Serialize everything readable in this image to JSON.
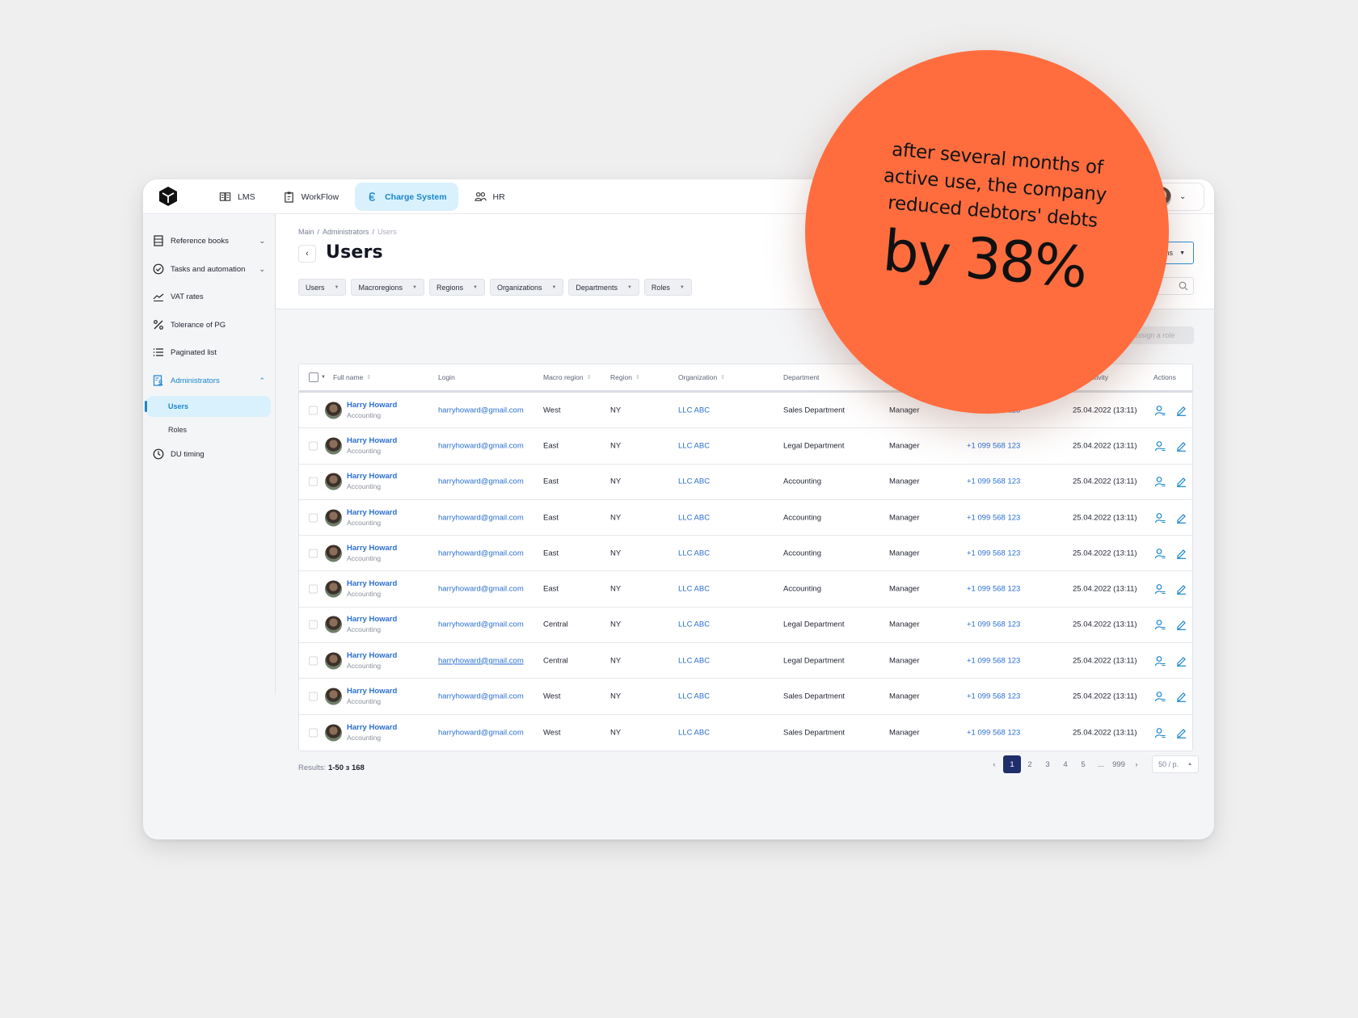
{
  "nav": {
    "items": [
      {
        "label": "LMS",
        "icon": "book-icon",
        "active": false
      },
      {
        "label": "WorkFlow",
        "icon": "clipboard-icon",
        "active": false
      },
      {
        "label": "Charge System",
        "icon": "charge-icon",
        "active": true
      },
      {
        "label": "HR",
        "icon": "people-icon",
        "active": false
      }
    ]
  },
  "sidebar": {
    "items": [
      {
        "label": "Reference books",
        "icon": "book-list-icon",
        "expandable": "down"
      },
      {
        "label": "Tasks and automation",
        "icon": "check-circle-icon",
        "expandable": "down"
      },
      {
        "label": "VAT rates",
        "icon": "trend-icon"
      },
      {
        "label": "Tolerance of PG",
        "icon": "percent-icon"
      },
      {
        "label": "Paginated list",
        "icon": "list-icon"
      },
      {
        "label": "Administrators",
        "icon": "admin-icon",
        "expandable": "up",
        "active": true
      },
      {
        "label": "DU timing",
        "icon": "clock-icon"
      }
    ],
    "subitems": [
      {
        "label": "Users",
        "active": true
      },
      {
        "label": "Roles",
        "active": false
      }
    ]
  },
  "breadcrumb": [
    "Main",
    "Administrators",
    "Users"
  ],
  "page": {
    "title": "Users",
    "right_select_label": "ns",
    "reassign_label": "Reassign a role"
  },
  "filters": [
    "Users",
    "Macroregions",
    "Regions",
    "Organizations",
    "Departments",
    "Roles"
  ],
  "table": {
    "columns": [
      "Full name",
      "Login",
      "Macro region",
      "Region",
      "Organization",
      "Department",
      "",
      "",
      "activity",
      "Actions"
    ],
    "rows": [
      {
        "name": "Harry Howard",
        "sub": "Accounting",
        "login": "harryhoward@gmail.com",
        "macro": "West",
        "region": "NY",
        "org": "LLC ABC",
        "dept": "Sales Department",
        "role": "Manager",
        "phone": "+1 099 568 123",
        "activity": "25.04.2022 (13:11)"
      },
      {
        "name": "Harry Howard",
        "sub": "Accounting",
        "login": "harryhoward@gmail.com",
        "macro": "East",
        "region": "NY",
        "org": "LLC ABC",
        "dept": "Legal Department",
        "role": "Manager",
        "phone": "+1 099 568 123",
        "activity": "25.04.2022 (13:11)"
      },
      {
        "name": "Harry Howard",
        "sub": "Accounting",
        "login": "harryhoward@gmail.com",
        "macro": "East",
        "region": "NY",
        "org": "LLC ABC",
        "dept": "Accounting",
        "role": "Manager",
        "phone": "+1 099 568 123",
        "activity": "25.04.2022 (13:11)"
      },
      {
        "name": "Harry Howard",
        "sub": "Accounting",
        "login": "harryhoward@gmail.com",
        "macro": "East",
        "region": "NY",
        "org": "LLC ABC",
        "dept": "Accounting",
        "role": "Manager",
        "phone": "+1 099 568 123",
        "activity": "25.04.2022 (13:11)"
      },
      {
        "name": "Harry Howard",
        "sub": "Accounting",
        "login": "harryhoward@gmail.com",
        "macro": "East",
        "region": "NY",
        "org": "LLC ABC",
        "dept": "Accounting",
        "role": "Manager",
        "phone": "+1 099 568 123",
        "activity": "25.04.2022 (13:11)"
      },
      {
        "name": "Harry Howard",
        "sub": "Accounting",
        "login": "harryhoward@gmail.com",
        "macro": "East",
        "region": "NY",
        "org": "LLC ABC",
        "dept": "Accounting",
        "role": "Manager",
        "phone": "+1 099 568 123",
        "activity": "25.04.2022 (13:11)"
      },
      {
        "name": "Harry Howard",
        "sub": "Accounting",
        "login": "harryhoward@gmail.com",
        "macro": "Central",
        "region": "NY",
        "org": "LLC ABC",
        "dept": "Legal Department",
        "role": "Manager",
        "phone": "+1 099 568 123",
        "activity": "25.04.2022 (13:11)"
      },
      {
        "name": "Harry Howard",
        "sub": "Accounting",
        "login": "harryhoward@gmail.com",
        "macro": "Central",
        "region": "NY",
        "org": "LLC ABC",
        "dept": "Legal Department",
        "role": "Manager",
        "phone": "+1 099 568 123",
        "activity": "25.04.2022 (13:11)",
        "hover": true
      },
      {
        "name": "Harry Howard",
        "sub": "Accounting",
        "login": "harryhoward@gmail.com",
        "macro": "West",
        "region": "NY",
        "org": "LLC ABC",
        "dept": "Sales Department",
        "role": "Manager",
        "phone": "+1 099 568 123",
        "activity": "25.04.2022 (13:11)"
      },
      {
        "name": "Harry Howard",
        "sub": "Accounting",
        "login": "harryhoward@gmail.com",
        "macro": "West",
        "region": "NY",
        "org": "LLC ABC",
        "dept": "Sales Department",
        "role": "Manager",
        "phone": "+1 099 568 123",
        "activity": "25.04.2022 (13:11)"
      }
    ]
  },
  "footer": {
    "results_label": "Results:",
    "results_value": "1-50 з 168",
    "pages": [
      "1",
      "2",
      "3",
      "4",
      "5",
      "...",
      "999"
    ],
    "current_page": "1",
    "per_page": "50 / p."
  },
  "promo": {
    "lines": [
      "after several months of",
      "active use, the company",
      "reduced debtors' debts"
    ],
    "highlight": "by 38%",
    "color": "#ff6d3f"
  },
  "colors": {
    "accent": "#1a86cc",
    "link": "#2a6fd1",
    "active_bg": "#d9f1fd",
    "pager_active": "#1f2e6a"
  }
}
